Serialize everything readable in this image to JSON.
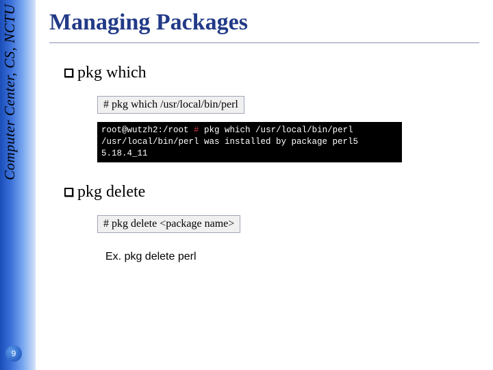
{
  "sidebar": {
    "label": "Computer Center, CS, NCTU"
  },
  "slide": {
    "number": "9",
    "title": "Managing Packages"
  },
  "sections": [
    {
      "heading": "pkg which",
      "command": "#  pkg which /usr/local/bin/perl",
      "terminal": {
        "prompt": "root@wutzh2:/root ",
        "pound": "#",
        "cmd": " pkg which /usr/local/bin/perl",
        "output": "/usr/local/bin/perl was installed by package perl5 5.18.4_11"
      }
    },
    {
      "heading": "pkg delete",
      "command": "#  pkg delete <package name>",
      "example": "Ex. pkg delete perl"
    }
  ]
}
